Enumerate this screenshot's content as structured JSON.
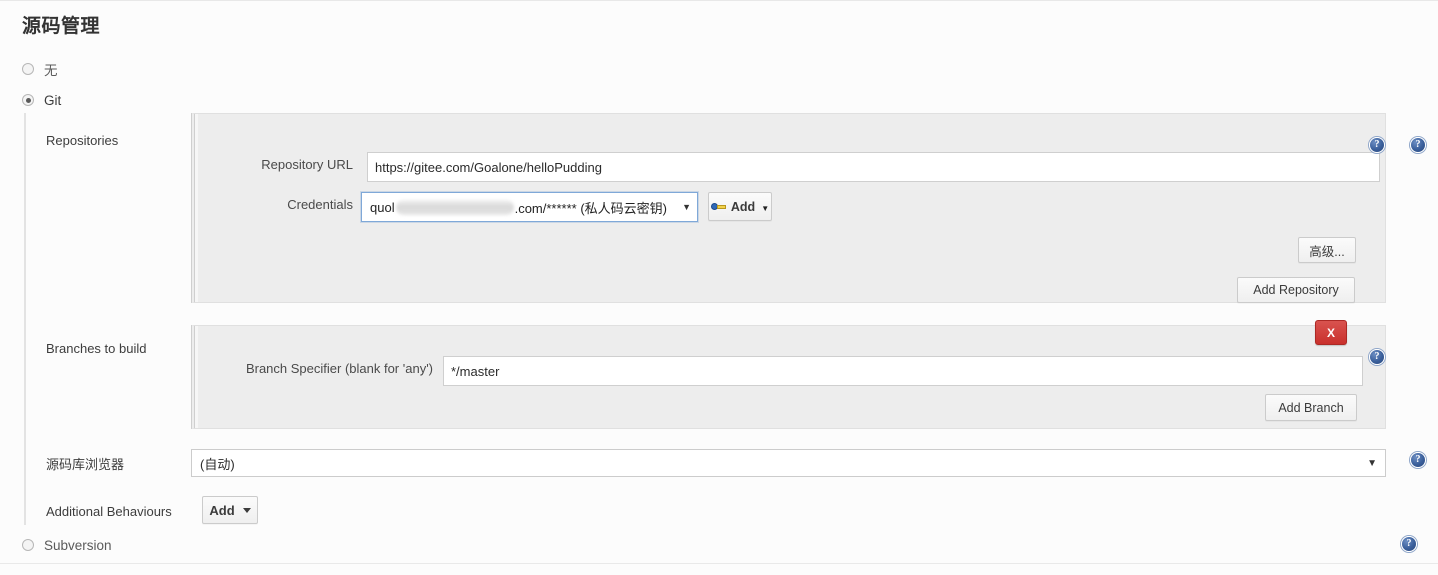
{
  "page": {
    "title": "源码管理"
  },
  "scm_options": [
    {
      "label": "无",
      "selected": false
    },
    {
      "label": "Git",
      "selected": true
    },
    {
      "label": "Subversion",
      "selected": false
    }
  ],
  "git": {
    "repositories": {
      "row_label": "Repositories",
      "repository_url": {
        "label": "Repository URL",
        "value": "https://gitee.com/Goalone/helloPudding"
      },
      "credentials": {
        "label": "Credentials",
        "value_prefix": "quol",
        "value_redacted": "████████████",
        "value_suffix": ".com/****** (私人码云密钥)",
        "add_button": "Add"
      },
      "advanced_button": "高级...",
      "add_repository_button": "Add Repository"
    },
    "branches": {
      "row_label": "Branches to build",
      "branch_specifier": {
        "label": "Branch Specifier (blank for 'any')",
        "value": "*/master"
      },
      "delete_button": "X",
      "add_branch_button": "Add Branch"
    },
    "repository_browser": {
      "row_label": "源码库浏览器",
      "selected": "(自动)"
    },
    "additional_behaviours": {
      "row_label": "Additional Behaviours",
      "add_button": "Add"
    }
  },
  "icons": {
    "help": "?"
  }
}
